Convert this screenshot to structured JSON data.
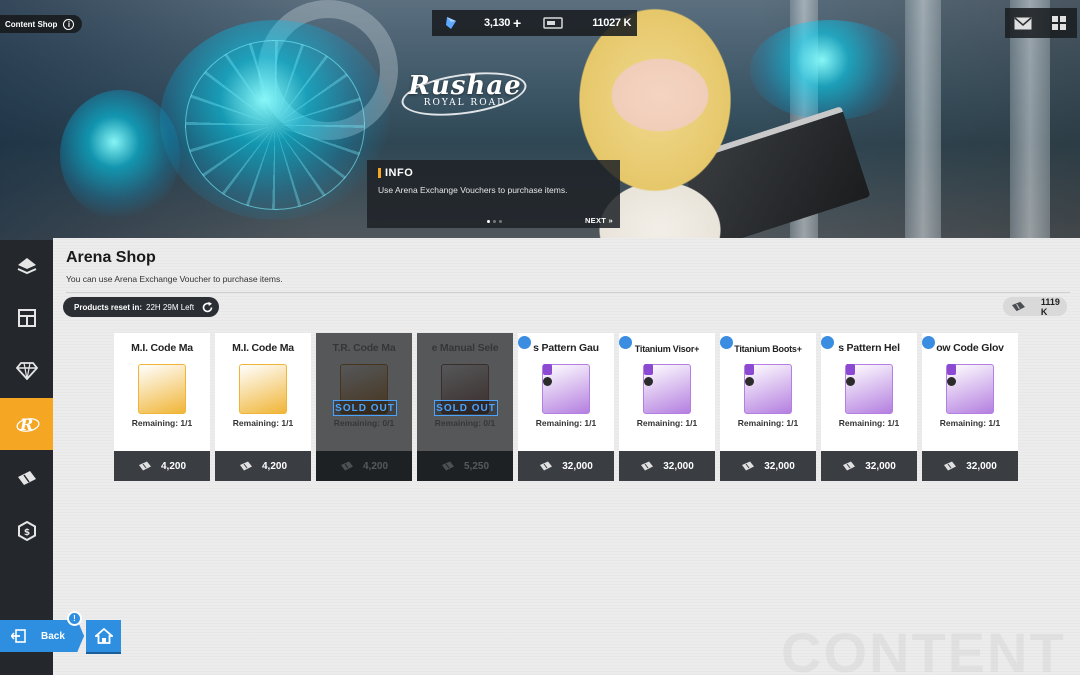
{
  "header": {
    "content_shop_label": "Content Shop",
    "currency_gems": "3,130",
    "currency_plus": "+",
    "currency_credits": "11027 K"
  },
  "banner": {
    "logo_title": "Rushae",
    "logo_subtitle": "ROYAL ROAD"
  },
  "info_panel": {
    "title": "INFO",
    "text": "Use Arena Exchange Vouchers to purchase items.",
    "next_label": "NEXT »"
  },
  "shop": {
    "title": "Arena Shop",
    "description": "You can use Arena Exchange Voucher to purchase items.",
    "reset_label": "Products reset in:",
    "reset_time": "22H 29M Left",
    "voucher_count": "1119 K",
    "watermark": "CONTENT",
    "items": [
      {
        "name": "M.I. Code Ma",
        "remaining": "Remaining: 1/1",
        "price": "4,200",
        "sold_out": false,
        "color": "#f0b537"
      },
      {
        "name": "M.I. Code Ma",
        "remaining": "Remaining: 1/1",
        "price": "4,200",
        "sold_out": false,
        "color": "#f0b537"
      },
      {
        "name": "T.R. Code Ma",
        "remaining": "Remaining: 0/1",
        "price": "4,200",
        "sold_out": true,
        "sold_out_label": "SOLD OUT",
        "color": "#c9812a"
      },
      {
        "name": "e Manual Sele",
        "remaining": "Remaining: 0/1",
        "price": "5,250",
        "sold_out": true,
        "sold_out_label": "SOLD OUT",
        "color": "#9d6a5c"
      },
      {
        "name": "s Pattern Gau",
        "remaining": "Remaining: 1/1",
        "price": "32,000",
        "sold_out": false,
        "color": "#b47fe0"
      },
      {
        "name": "Titanium Visor+",
        "remaining": "Remaining: 1/1",
        "price": "32,000",
        "sold_out": false,
        "color": "#b47fe0"
      },
      {
        "name": "Titanium Boots+",
        "remaining": "Remaining: 1/1",
        "price": "32,000",
        "sold_out": false,
        "color": "#b47fe0"
      },
      {
        "name": "s Pattern Hel",
        "remaining": "Remaining: 1/1",
        "price": "32,000",
        "sold_out": false,
        "color": "#b47fe0"
      },
      {
        "name": "ow Code Glov",
        "remaining": "Remaining: 1/1",
        "price": "32,000",
        "sold_out": false,
        "color": "#b47fe0"
      }
    ]
  },
  "nav": {
    "back_label": "Back",
    "notification_badge": "!"
  },
  "colors": {
    "accent": "#f5a623",
    "nav_blue": "#2e8fe0",
    "sold_out_blue": "#4aa3ff"
  }
}
